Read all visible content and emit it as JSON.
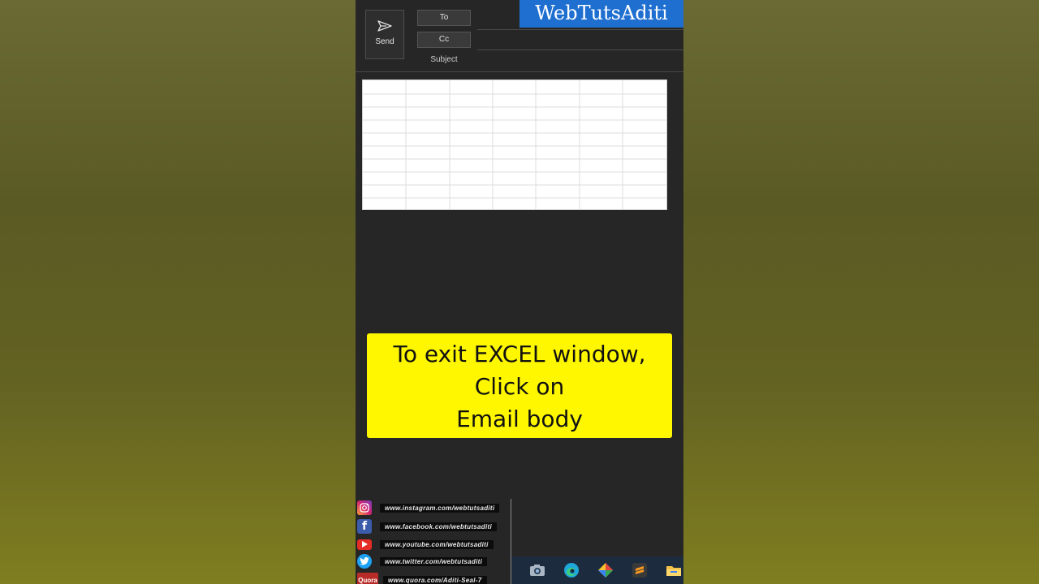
{
  "compose": {
    "send_label": "Send",
    "to_label": "To",
    "cc_label": "Cc",
    "subject_label": "Subject"
  },
  "brand": "WebTutsAditi",
  "callout": {
    "line1": "To exit EXCEL window,",
    "line2": "Click on",
    "line3": "Email body",
    "background": "#fff700"
  },
  "social": [
    {
      "icon": "instagram-icon",
      "url": "www.instagram.com/webtutsaditi"
    },
    {
      "icon": "facebook-icon",
      "url": "www.facebook.com/webtutsaditi"
    },
    {
      "icon": "youtube-icon",
      "url": "www.youtube.com/webtutsaditi"
    },
    {
      "icon": "twitter-icon",
      "url": "www.twitter.com/webtutsaditi"
    },
    {
      "icon": "quora-icon",
      "label": "Quora",
      "url": "www.quora.com/Aditi-Seal-7"
    }
  ],
  "taskbar": [
    "camera-icon",
    "edge-browser-icon",
    "app-diamond-icon",
    "sublime-text-icon",
    "file-explorer-icon"
  ],
  "colors": {
    "panel": "#262626",
    "brand_bg": "#1f6fd1",
    "taskbar": "#1c2b3d"
  }
}
